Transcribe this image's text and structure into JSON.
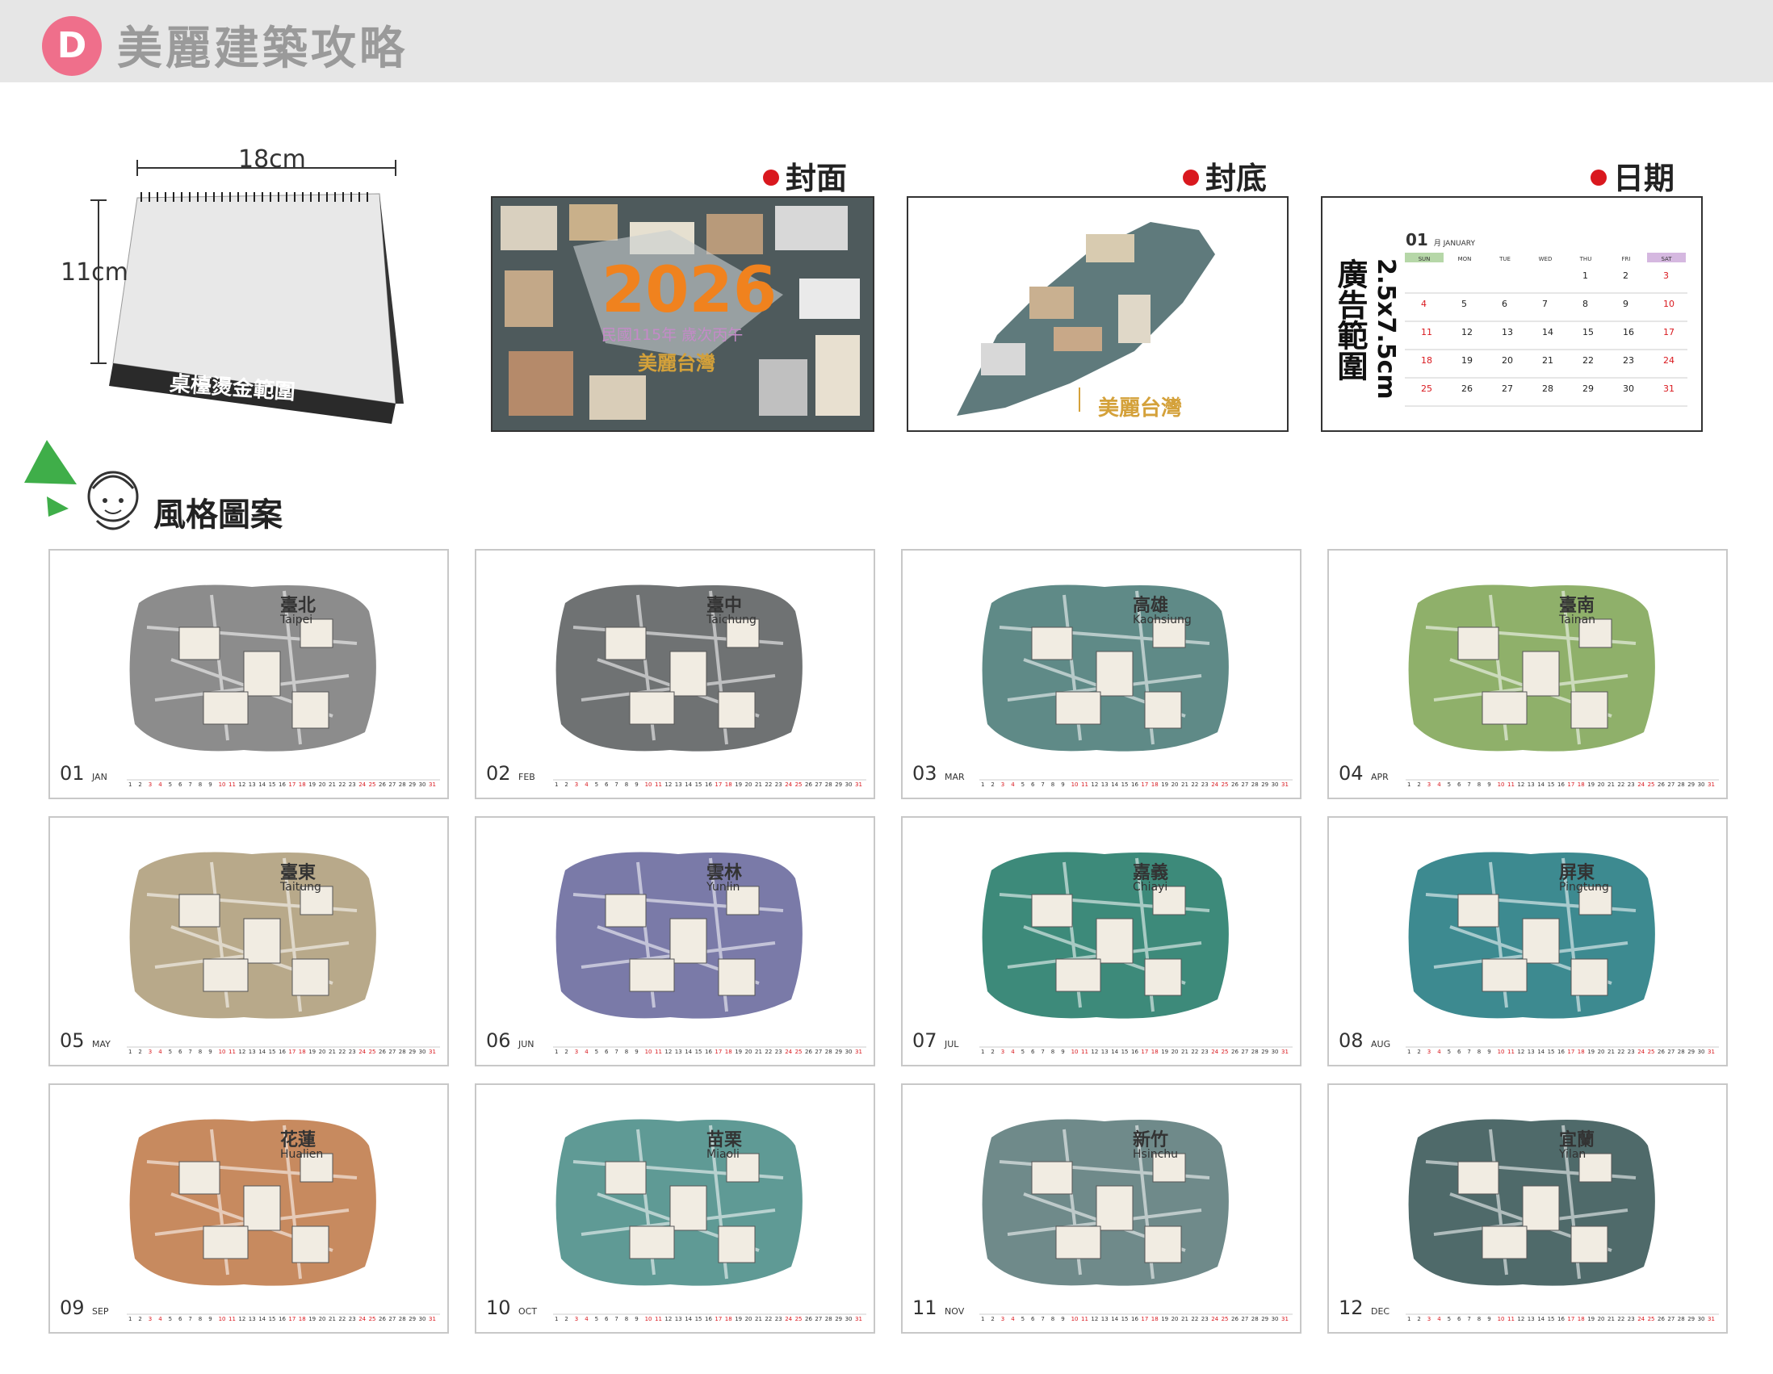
{
  "header": {
    "badge": "D",
    "title": "美麗建築攻略"
  },
  "desk_calendar": {
    "width_label": "18cm",
    "height_label": "11cm",
    "base_label": "桌檯燙金範圍"
  },
  "labels": {
    "cover": "封面",
    "back": "封底",
    "date": "日期"
  },
  "cover": {
    "year": "2026",
    "roc": "民國115年 歲次丙午",
    "brand": "美麗台灣"
  },
  "back": {
    "brand": "美麗台灣"
  },
  "date_page": {
    "month_num": "01",
    "month_name": "月 JANUARY",
    "ad_text": "廣告範圍",
    "ad_size": "2.5x7.5cm",
    "weekdays": [
      "SUN",
      "MON",
      "TUE",
      "WED",
      "THU",
      "FRI",
      "SAT"
    ],
    "rows": [
      [
        "",
        "",
        "",
        "",
        "1",
        "2",
        "3"
      ],
      [
        "4",
        "5",
        "6",
        "7",
        "8",
        "9",
        "10"
      ],
      [
        "11",
        "12",
        "13",
        "14",
        "15",
        "16",
        "17"
      ],
      [
        "18",
        "19",
        "20",
        "21",
        "22",
        "23",
        "24"
      ],
      [
        "25",
        "26",
        "27",
        "28",
        "29",
        "30",
        "31"
      ]
    ]
  },
  "style_section": {
    "title": "風格圖案"
  },
  "months": [
    {
      "num": "01",
      "name": "JAN",
      "city": "臺北",
      "city_en": "Taipei",
      "color": "#8c8c8c"
    },
    {
      "num": "02",
      "name": "FEB",
      "city": "臺中",
      "city_en": "Taichung",
      "color": "#6f7273"
    },
    {
      "num": "03",
      "name": "MAR",
      "city": "高雄",
      "city_en": "Kaohsiung",
      "color": "#5f8a87"
    },
    {
      "num": "04",
      "name": "APR",
      "city": "臺南",
      "city_en": "Tainan",
      "color": "#8fb06a"
    },
    {
      "num": "05",
      "name": "MAY",
      "city": "臺東",
      "city_en": "Taitung",
      "color": "#b8a98a"
    },
    {
      "num": "06",
      "name": "JUN",
      "city": "雲林",
      "city_en": "Yunlin",
      "color": "#7a7aa8"
    },
    {
      "num": "07",
      "name": "JUL",
      "city": "嘉義",
      "city_en": "Chiayi",
      "color": "#3d8a7a"
    },
    {
      "num": "08",
      "name": "AUG",
      "city": "屏東",
      "city_en": "Pingtung",
      "color": "#3d8a90"
    },
    {
      "num": "09",
      "name": "SEP",
      "city": "花蓮",
      "city_en": "Hualien",
      "color": "#c78a5f"
    },
    {
      "num": "10",
      "name": "OCT",
      "city": "苗栗",
      "city_en": "Miaoli",
      "color": "#5f9a95"
    },
    {
      "num": "11",
      "name": "NOV",
      "city": "新竹",
      "city_en": "Hsinchu",
      "color": "#6f8a8a"
    },
    {
      "num": "12",
      "name": "DEC",
      "city": "宜蘭",
      "city_en": "Yilan",
      "color": "#4f6a6a"
    }
  ],
  "colors": {
    "header_bg": "#e6e6e6",
    "badge": "#ef6f8b",
    "red_dot": "#d9181e",
    "orange": "#f0821e",
    "gold": "#d4a13a"
  }
}
